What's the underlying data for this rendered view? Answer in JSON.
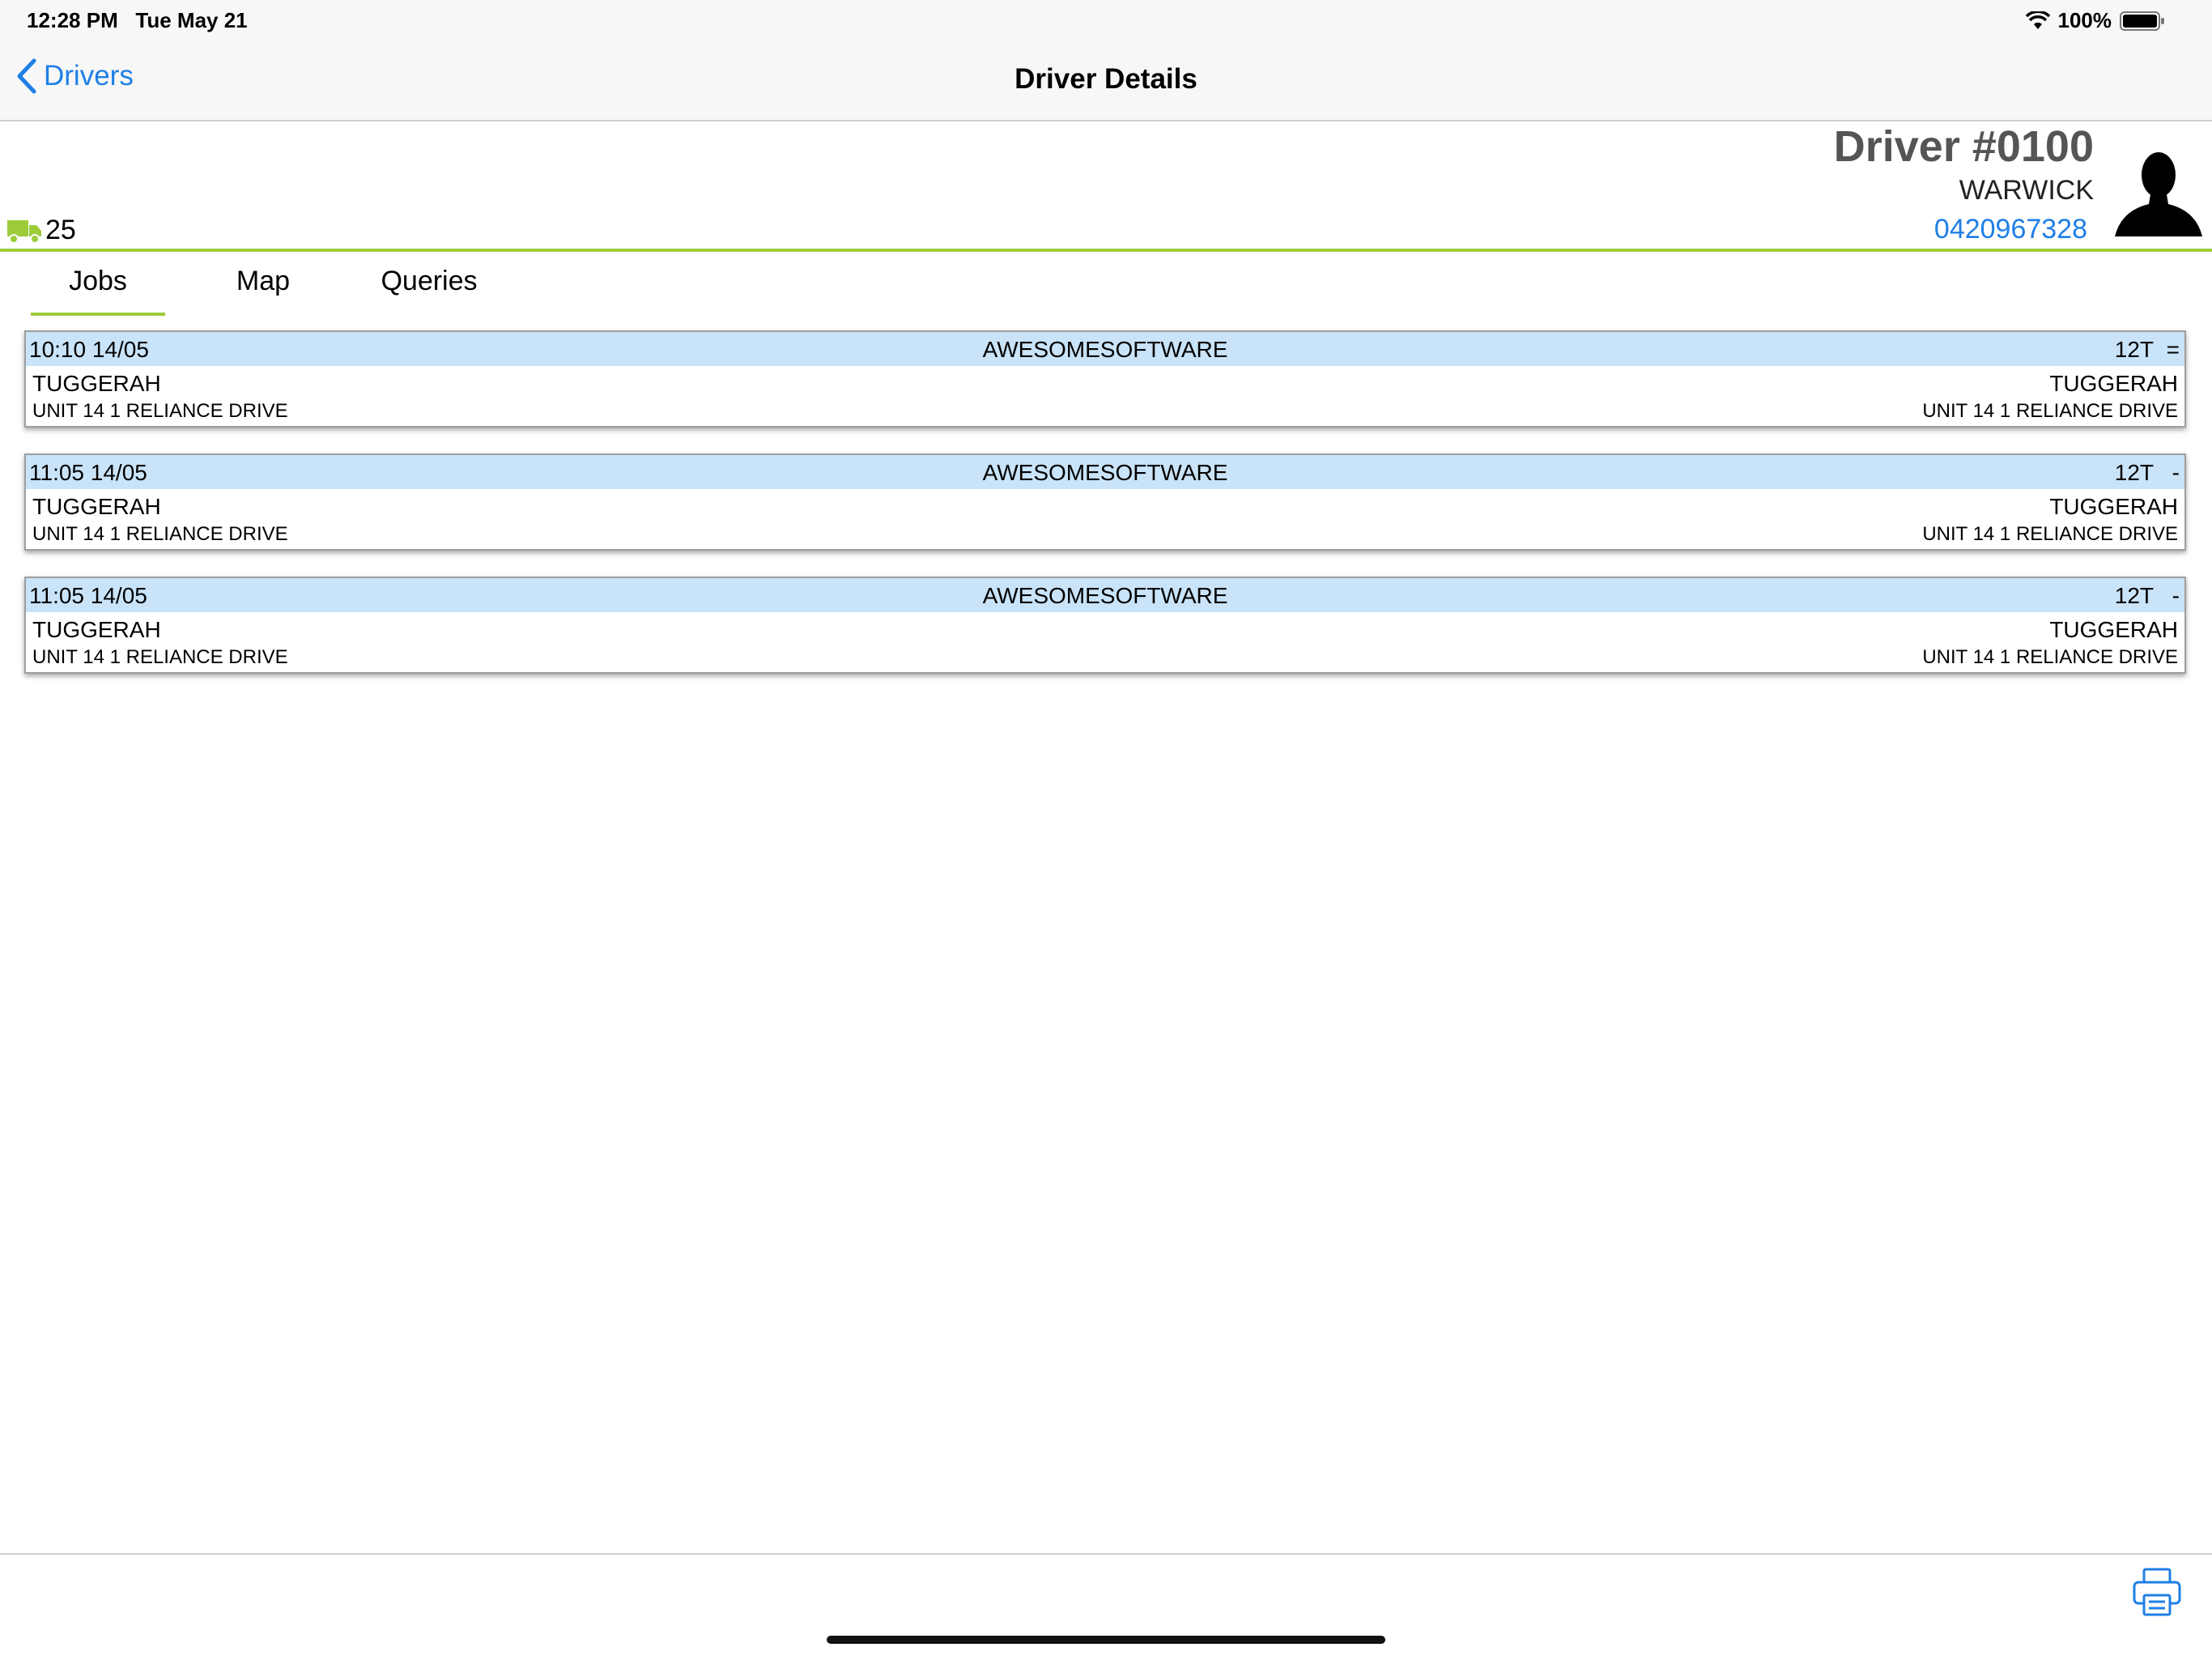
{
  "status_bar": {
    "time": "12:28 PM",
    "date": "Tue May 21",
    "wifi_icon": "wifi-icon",
    "battery_percent": "100%",
    "battery_icon": "battery-icon"
  },
  "nav": {
    "back_label": "Drivers",
    "back_icon": "chevron-left-icon",
    "title": "Driver Details"
  },
  "driver": {
    "number": "Driver #0100",
    "name": "WARWICK",
    "phone": "0420967328",
    "avatar_icon": "person-silhouette-icon",
    "vehicle_icon": "truck-icon",
    "vehicle_count": "25"
  },
  "tabs": [
    {
      "label": "Jobs",
      "selected": true
    },
    {
      "label": "Map"
    },
    {
      "label": "Queries"
    }
  ],
  "jobs": [
    {
      "time": "10:10 14/05",
      "company": "AWESOMESOFTWARE",
      "weight": "12T",
      "flag": "=",
      "from_city": "TUGGERAH",
      "from_address": "UNIT 14 1 RELIANCE DRIVE",
      "to_city": "TUGGERAH",
      "to_address": "UNIT 14 1 RELIANCE DRIVE"
    },
    {
      "time": "11:05 14/05",
      "company": "AWESOMESOFTWARE",
      "weight": "12T",
      "flag": "-",
      "from_city": "TUGGERAH",
      "from_address": "UNIT 14 1 RELIANCE DRIVE",
      "to_city": "TUGGERAH",
      "to_address": "UNIT 14 1 RELIANCE DRIVE"
    },
    {
      "time": "11:05 14/05",
      "company": "AWESOMESOFTWARE",
      "weight": "12T",
      "flag": "-",
      "from_city": "TUGGERAH",
      "from_address": "UNIT 14 1 RELIANCE DRIVE",
      "to_city": "TUGGERAH",
      "to_address": "UNIT 14 1 RELIANCE DRIVE"
    }
  ],
  "toolbar": {
    "print_icon": "printer-icon"
  },
  "colors": {
    "accent_green": "#9ccc3a",
    "link_blue": "#1f7fe6",
    "job_header_bg": "#c9e3f8"
  }
}
